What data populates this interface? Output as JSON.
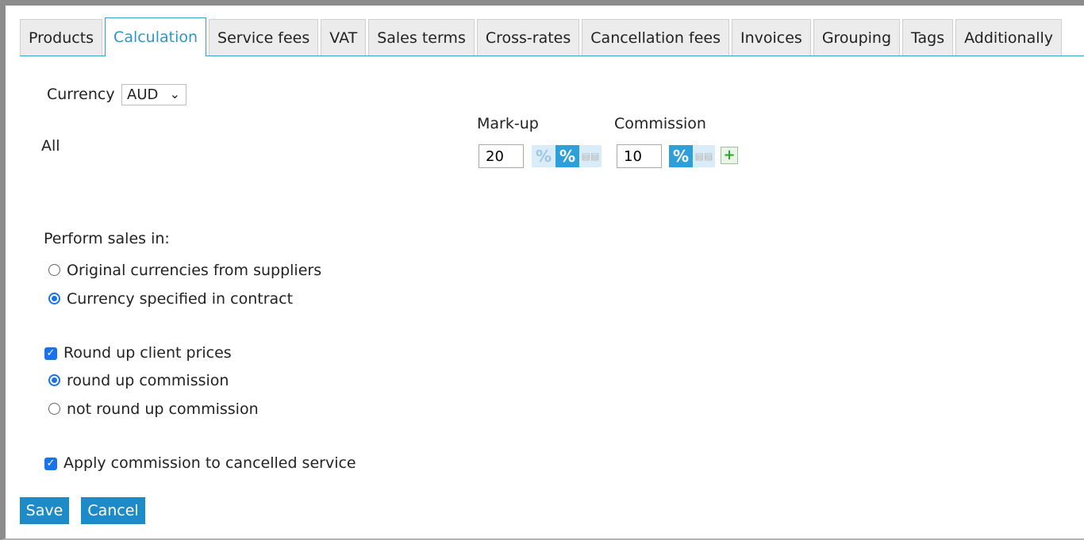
{
  "tabs": [
    {
      "label": "Products",
      "active": false
    },
    {
      "label": "Calculation",
      "active": true
    },
    {
      "label": "Service fees",
      "active": false
    },
    {
      "label": "VAT",
      "active": false
    },
    {
      "label": "Sales terms",
      "active": false
    },
    {
      "label": "Cross-rates",
      "active": false
    },
    {
      "label": "Cancellation fees",
      "active": false
    },
    {
      "label": "Invoices",
      "active": false
    },
    {
      "label": "Grouping",
      "active": false
    },
    {
      "label": "Tags",
      "active": false
    },
    {
      "label": "Additionally",
      "active": false
    }
  ],
  "currency": {
    "label": "Currency",
    "selected": "AUD"
  },
  "pricing": {
    "row_label": "All",
    "markup": {
      "label": "Mark-up",
      "value": "20",
      "pct_symbol": "%"
    },
    "commission": {
      "label": "Commission",
      "value": "10",
      "pct_symbol": "%",
      "add_symbol": "+"
    }
  },
  "sales": {
    "heading": "Perform sales in:",
    "options": [
      {
        "label": "Original currencies from suppliers",
        "checked": false
      },
      {
        "label": "Currency specified in contract",
        "checked": true
      }
    ]
  },
  "rounding": {
    "checkbox_label": "Round up client prices",
    "checked": true,
    "options": [
      {
        "label": "round up commission",
        "checked": true
      },
      {
        "label": "not round up commission",
        "checked": false
      }
    ]
  },
  "cancelled": {
    "label": "Apply commission to cancelled service",
    "checked": true
  },
  "actions": {
    "save": "Save",
    "cancel": "Cancel"
  },
  "colors": {
    "accent": "#1d8bc8",
    "tab_active_text": "#2f95c6",
    "add_green": "#2aa52a"
  }
}
